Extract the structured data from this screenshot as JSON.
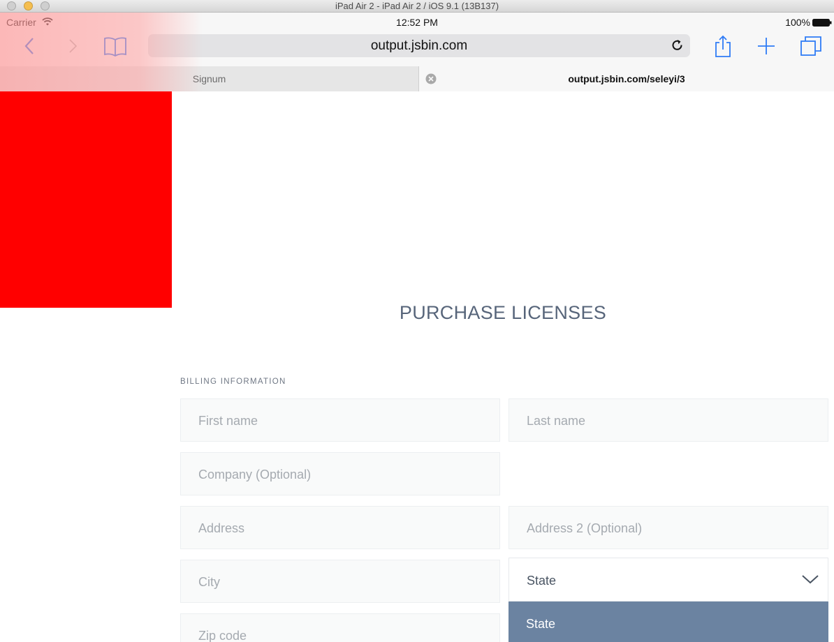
{
  "window": {
    "title": "iPad Air 2 - iPad Air 2 / iOS 9.1 (13B137)"
  },
  "status_bar": {
    "carrier": "Carrier",
    "time": "12:52 PM",
    "battery": "100%"
  },
  "toolbar": {
    "url": "output.jsbin.com",
    "icons": [
      "back-icon",
      "forward-icon",
      "bookmarks-icon",
      "reload-icon",
      "share-icon",
      "new-tab-icon",
      "tabs-icon"
    ]
  },
  "tabs": [
    {
      "label": "Signum",
      "active": false
    },
    {
      "label": "output.jsbin.com/seleyi/3",
      "active": true
    }
  ],
  "page": {
    "red_box_color": "#ff0000",
    "title": "PURCHASE LICENSES",
    "section_label": "BILLING INFORMATION",
    "fields": {
      "first_name": "First name",
      "last_name": "Last name",
      "company": "Company (Optional)",
      "address": "Address",
      "address2": "Address 2 (Optional)",
      "city": "City",
      "zip": "Zip code"
    },
    "state_select": {
      "value": "State",
      "highlighted_option": "State"
    }
  },
  "colors": {
    "accent": "#2f7cf6",
    "title": "#57657a",
    "dropdown_highlight": "#6b83a1",
    "red_box": "#ff0000"
  }
}
